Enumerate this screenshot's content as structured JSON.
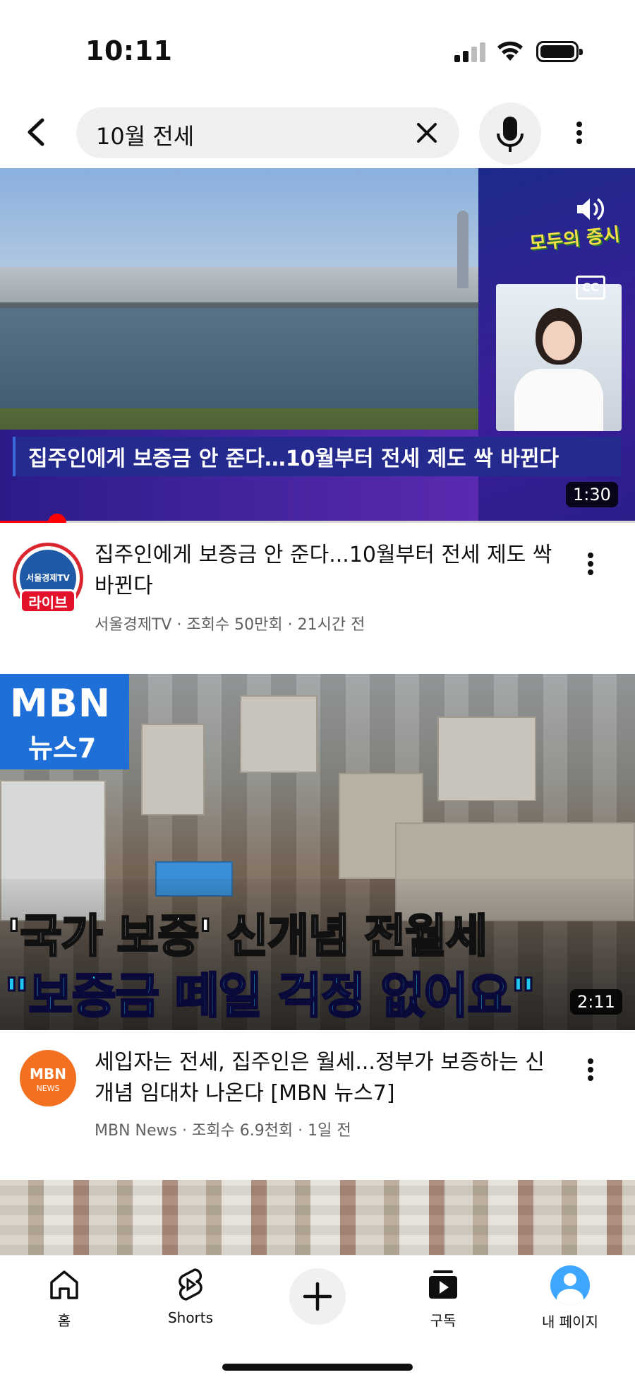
{
  "status_bar": {
    "time": "10:11"
  },
  "search": {
    "query": "10월 전세"
  },
  "videos": [
    {
      "thumbnail_title": "집주인에게 보증금 안 준다…10월부터 전세 제도 싹 바뀐다",
      "thumbnail_logo": "모두의 증시",
      "duration": "1:30",
      "progress": 0.09,
      "title": "집주인에게 보증금 안 준다...10월부터 전세 제도 싹 바뀐다",
      "channel": "서울경제TV",
      "channel_avatar_text": "서울경제TV",
      "live_badge": "라이브",
      "views": "조회수 50만회",
      "age": "21시간 전"
    },
    {
      "thumbnail_brand": "MBN",
      "thumbnail_program": "뉴스7",
      "thumbnail_line1": "'국가 보증' 신개념 전월세",
      "thumbnail_line2": "\"보증금 떼일 걱정 없어요\"",
      "duration": "2:11",
      "title": "세입자는 전세, 집주인은 월세...정부가 보증하는 신개념 임대차 나온다 [MBN 뉴스7]",
      "channel": "MBN News",
      "channel_avatar_text": "MBN",
      "channel_avatar_sub": "NEWS",
      "views": "조회수 6.9천회",
      "age": "1일 전"
    }
  ],
  "nav": {
    "home": "홈",
    "shorts": "Shorts",
    "subscriptions": "구독",
    "you": "내 페이지"
  },
  "colors": {
    "accent": "#ff0000",
    "mbn_orange": "#f37021",
    "live_red": "#e3122a"
  }
}
